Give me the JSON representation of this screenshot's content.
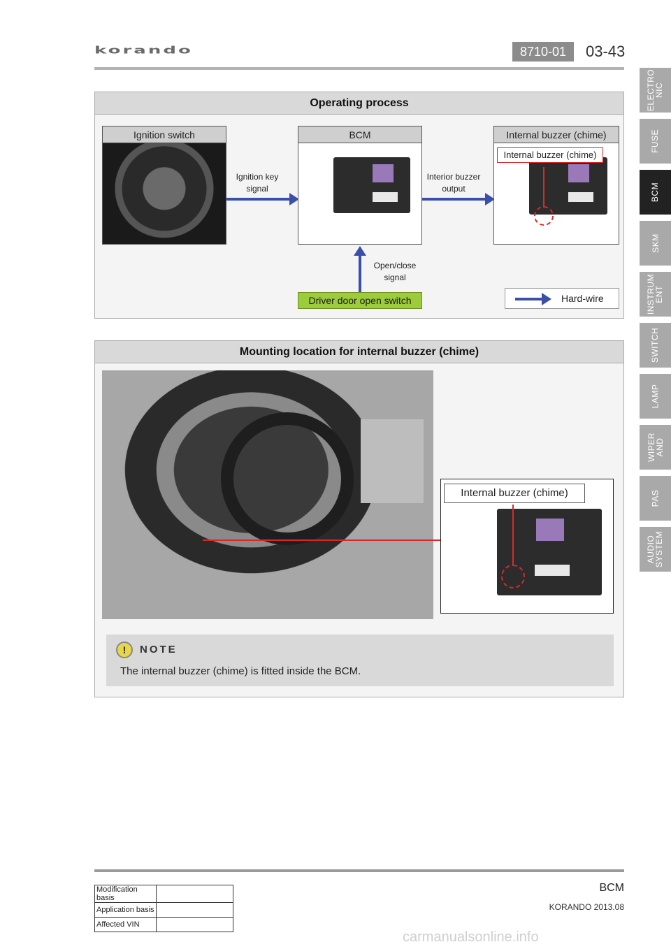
{
  "header": {
    "logo": "korando",
    "section_code": "8710-01",
    "page_number": "03-43"
  },
  "side_tabs": [
    {
      "label": "ELECTRO\nNIC",
      "active": false
    },
    {
      "label": "FUSE",
      "active": false
    },
    {
      "label": "BCM",
      "active": true
    },
    {
      "label": "SKM",
      "active": false
    },
    {
      "label": "INSTRUM\nENT",
      "active": false
    },
    {
      "label": "SWITCH",
      "active": false
    },
    {
      "label": "LAMP",
      "active": false
    },
    {
      "label": "WIPER\nAND",
      "active": false
    },
    {
      "label": "PAS",
      "active": false
    },
    {
      "label": "AUDIO\nSYSTEM",
      "active": false
    }
  ],
  "operating_process": {
    "title": "Operating process",
    "ignition_switch": "Ignition switch",
    "bcm": "BCM",
    "buzzer_box": "Internal buzzer (chime)",
    "buzzer_callout": "Internal buzzer (chime)",
    "ignition_key_signal": "Ignition key\nsignal",
    "interior_buzzer_output": "Interior buzzer\noutput",
    "open_close_signal": "Open/close\nsignal",
    "driver_door_switch": "Driver door open switch",
    "legend_hardwire": "Hard-wire"
  },
  "mounting": {
    "title": "Mounting location for internal buzzer (chime)",
    "callout": "Internal buzzer (chime)"
  },
  "note": {
    "title": "NOTE",
    "text": "The internal buzzer (chime) is fitted inside the BCM."
  },
  "footer": {
    "title": "BCM",
    "subtitle": "KORANDO 2013.08",
    "rows": [
      {
        "label": "Modification basis",
        "value": ""
      },
      {
        "label": "Application basis",
        "value": ""
      },
      {
        "label": "Affected VIN",
        "value": ""
      }
    ],
    "watermark": "carmanualsonline.info"
  },
  "colors": {
    "arrow": "#3a4fa8",
    "green_box": "#9ccc3c",
    "highlight_red": "#d62a2a",
    "active_tab": "#222222"
  }
}
